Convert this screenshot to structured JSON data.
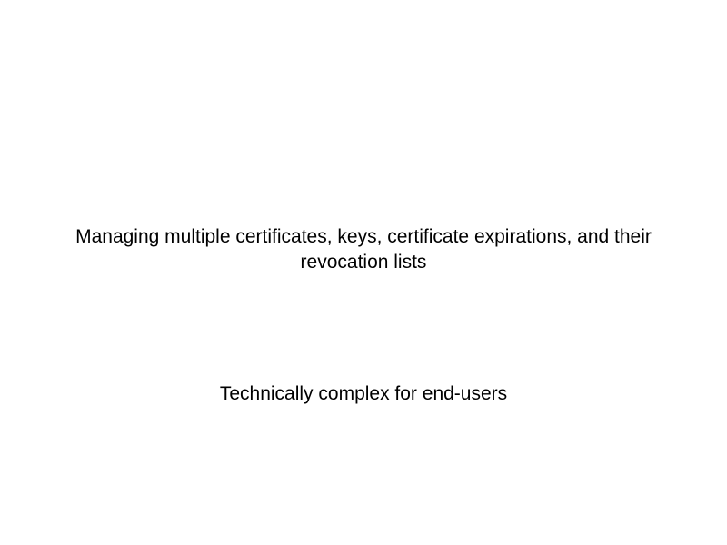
{
  "slide": {
    "line1": "Managing multiple certificates, keys, certificate expirations, and their revocation lists",
    "line2": "Technically complex for end-users"
  }
}
